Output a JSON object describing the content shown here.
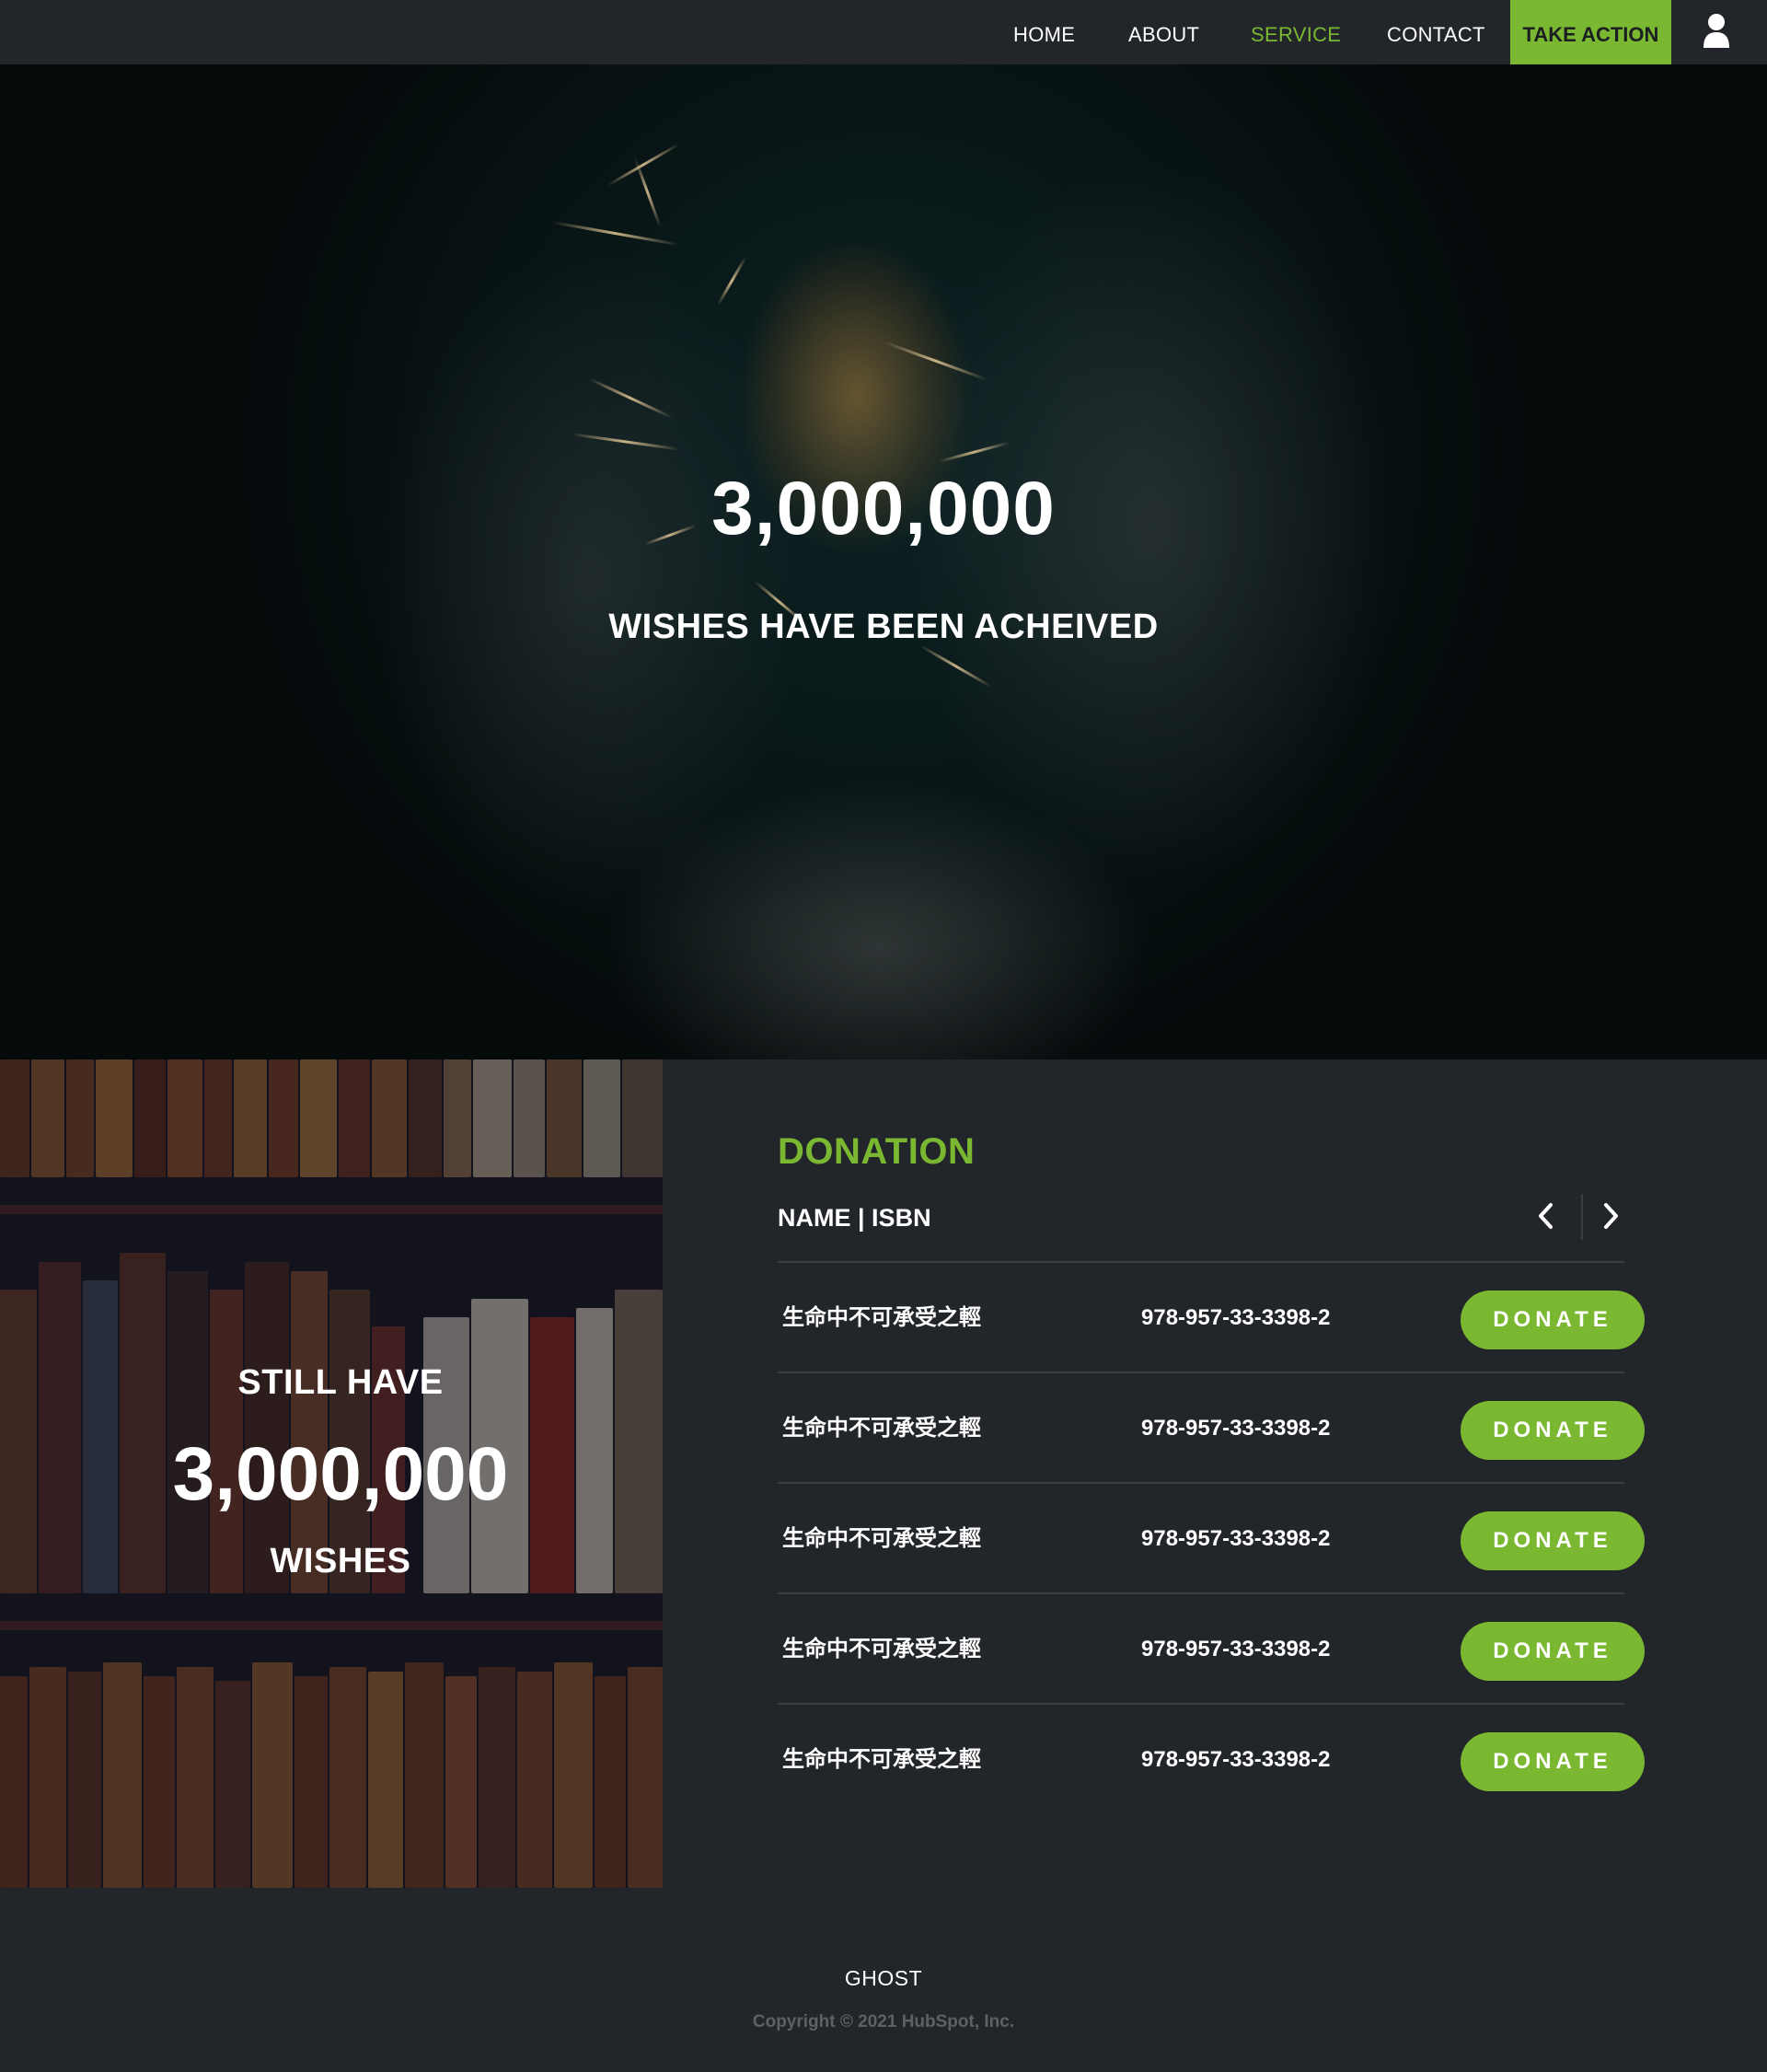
{
  "nav": {
    "links": [
      {
        "label": "HOME",
        "active": false
      },
      {
        "label": "ABOUT",
        "active": false
      },
      {
        "label": "SERVICE",
        "active": true
      },
      {
        "label": "CONTACT",
        "active": false
      }
    ],
    "cta_label": "TAKE ACTION",
    "user_icon": "user-icon"
  },
  "hero": {
    "number": "3,000,000",
    "caption": "WISHES HAVE BEEN ACHEIVED"
  },
  "shelf": {
    "line1": "STILL HAVE",
    "number": "3,000,000",
    "line3": "WISHES"
  },
  "donation": {
    "title": "DONATION",
    "header": "NAME | ISBN",
    "prev_icon": "chevron-left-icon",
    "next_icon": "chevron-right-icon",
    "rows": [
      {
        "name": "生命中不可承受之輕",
        "isbn": "978-957-33-3398-2",
        "button": "DONATE"
      },
      {
        "name": "生命中不可承受之輕",
        "isbn": "978-957-33-3398-2",
        "button": "DONATE"
      },
      {
        "name": "生命中不可承受之輕",
        "isbn": "978-957-33-3398-2",
        "button": "DONATE"
      },
      {
        "name": "生命中不可承受之輕",
        "isbn": "978-957-33-3398-2",
        "button": "DONATE"
      },
      {
        "name": "生命中不可承受之輕",
        "isbn": "978-957-33-3398-2",
        "button": "DONATE"
      }
    ]
  },
  "footer": {
    "brand": "GHOST",
    "copyright": "Copyright © 2021 HubSpot, Inc."
  },
  "colors": {
    "accent": "#7ab832",
    "background": "#222529",
    "text": "#ffffff",
    "muted": "#5d6166"
  }
}
